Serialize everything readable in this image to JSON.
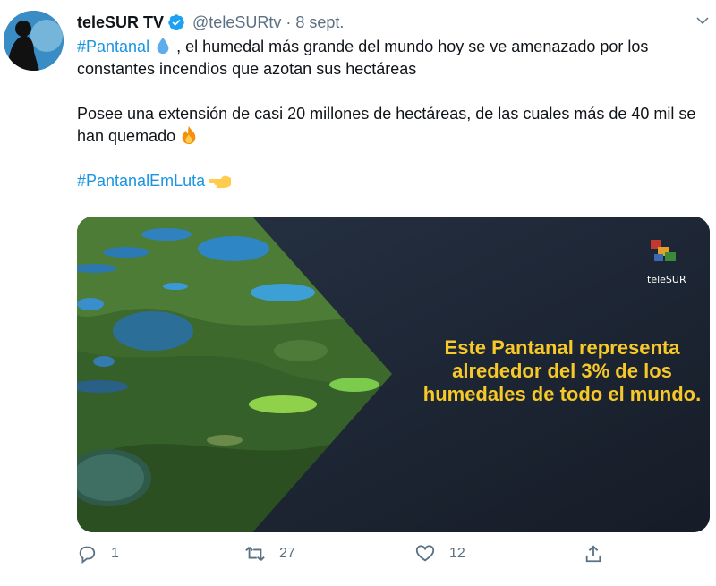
{
  "tweet": {
    "author_name": "teleSUR TV",
    "handle": "@teleSURtv",
    "separator": "·",
    "date": "8 sept.",
    "hashtag1": "#Pantanal",
    "line1_rest": ", el humedal más grande del mundo hoy se ve amenazado por los constantes incendios que azotan sus hectáreas",
    "para2": "Posee una extensión de casi 20 millones de hectáreas, de las cuales más de 40 mil se han quemado",
    "hashtag2": "#PantanalEmLuta"
  },
  "media": {
    "caption": "Este Pantanal representa alrededor del 3% de los humedales de todo el mundo.",
    "logo_text": "teleSUR"
  },
  "actions": {
    "reply_count": "1",
    "retweet_count": "27",
    "like_count": "12"
  },
  "colors": {
    "link": "#1b95e0",
    "caption": "#f7c928",
    "muted": "#5b7083",
    "panel": "#1e2633"
  },
  "icons": [
    "verified-badge-icon",
    "chevron-down-icon",
    "droplet-emoji",
    "fire-emoji",
    "pointing-left-emoji",
    "reply-icon",
    "retweet-icon",
    "like-icon",
    "share-icon"
  ]
}
